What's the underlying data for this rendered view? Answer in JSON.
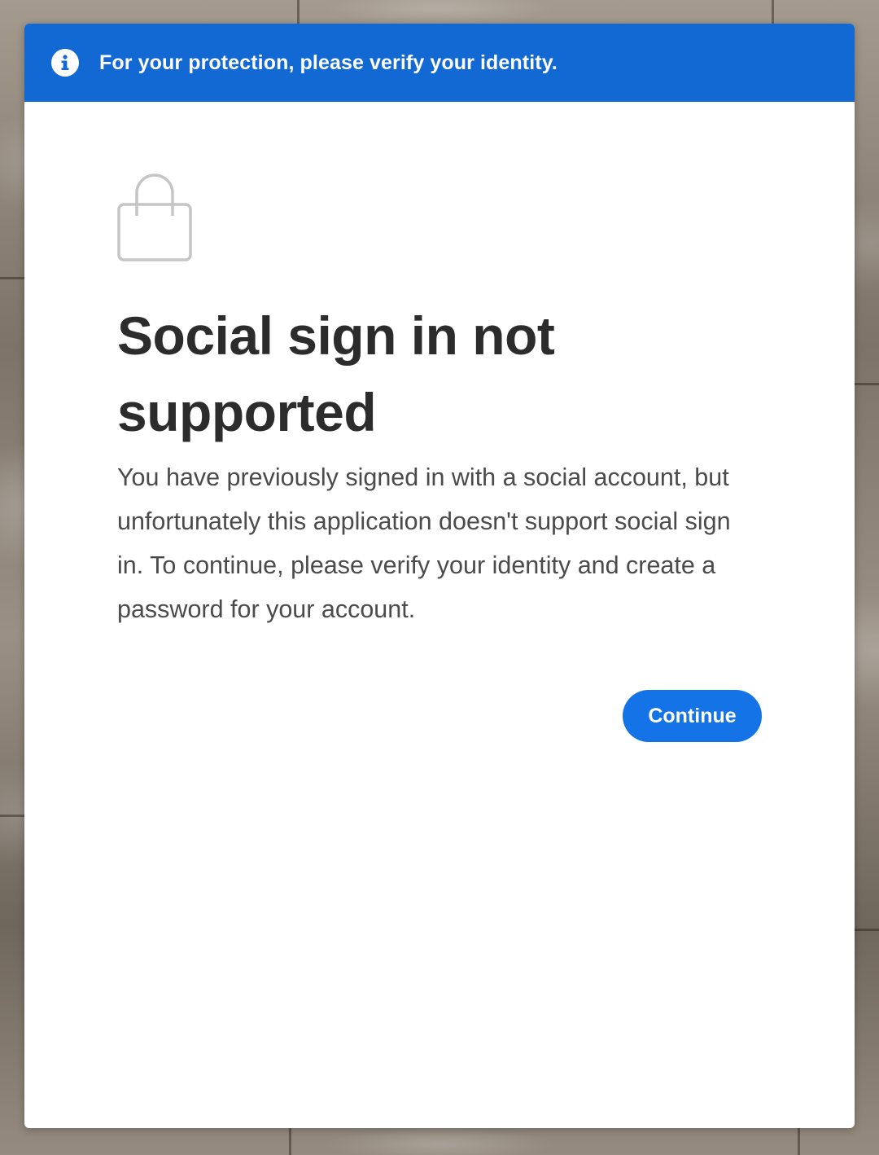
{
  "banner": {
    "icon": "info-icon",
    "message": "For your protection, please verify your identity.",
    "color": "#1269d3"
  },
  "main": {
    "icon": "lock-icon",
    "title": "Social sign in not supported",
    "description": "You have previously signed in with a social account, but unfortunately this application doesn't support social sign in. To continue, please verify your identity and create a password for your account.",
    "continue_label": "Continue",
    "accent_color": "#1473e6"
  }
}
